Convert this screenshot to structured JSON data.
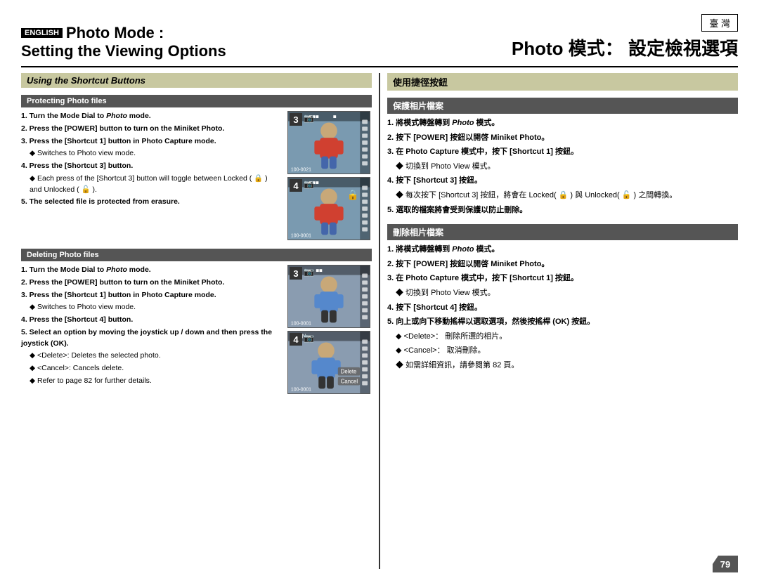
{
  "header": {
    "english_badge": "ENGLISH",
    "title_line1": "Photo Mode :",
    "title_line2": "Setting the Viewing Options",
    "taiwan_badge": "臺 灣",
    "chinese_title": "Photo 模式： 設定檢視選項"
  },
  "left": {
    "section_header": "Using the Shortcut Buttons",
    "protecting": {
      "subsection_header": "Protecting Photo files",
      "steps": [
        "1.  Turn the Mode Dial to Photo mode.",
        "2.  Press the [POWER] button to turn on the Miniket Photo.",
        "3.  Press the [Shortcut 1] button in Photo Capture mode.",
        "Switches to Photo view mode.",
        "4.  Press the [Shortcut 3] button.",
        "Each press of the [Shortcut 3] button will toggle between Locked ( 🔒 ) and Unlocked ( 🔓 ).",
        "5.  The selected file is protected from erasure."
      ]
    },
    "deleting": {
      "subsection_header": "Deleting Photo files",
      "steps": [
        "1.  Turn the Mode Dial to Photo mode.",
        "2.  Press the [POWER] button to turn on the Miniket Photo.",
        "3.  Press the [Shortcut 1] button in Photo Capture mode.",
        "Switches to Photo view mode.",
        "4.  Press the [Shortcut 4] button.",
        "5.  Select an option by moving the joystick up / down and then press the joystick (OK).",
        "<Delete>: Deletes the selected photo.",
        "<Cancel>: Cancels delete.",
        "Refer to page 82 for further details."
      ]
    }
  },
  "right": {
    "section_header": "使用捷徑按鈕",
    "protecting_header": "保護相片檔案",
    "protecting_steps": [
      "1.  將模式轉盤轉到 Photo 模式。",
      "2.  按下 [POWER] 按鈕以開啓 Miniket Photo。",
      "3.  在 Photo Capture 模式中，按下 [Shortcut 1] 按鈕。",
      "◆  切換到 Photo View 模式。",
      "4.  按下 [Shortcut 3] 按鈕。",
      "◆  每次按下 [Shortcut 3] 按鈕，將會在 Locked( 🔒 ) 與 Unlocked( 🔓 ) 之間轉換。",
      "5.  選取的檔案將會受到保護以防止刪除。"
    ],
    "deleting_header": "刪除相片檔案",
    "deleting_steps": [
      "1.  將模式轉盤轉到 Photo 模式。",
      "2.  按下 [POWER] 按鈕以開啓 Miniket Photo。",
      "3.  在 Photo Capture 模式中，按下 [Shortcut 1] 按鈕。",
      "◆  切換到 Photo View 模式。",
      "4.  按下 [Shortcut 4] 按鈕。",
      "5.  向上或向下移動搖桿以選取選項，然後按搖桿 (OK) 按鈕。",
      "◆  <Delete>：  刪除所選的相片。",
      "◆  <Cancel>：  取消刪除。",
      "◆  如需詳細資訊，請參閱第 82 頁。"
    ]
  },
  "page_number": "79",
  "camera_images": {
    "step3_counter": "100-0021",
    "step4_counter": "100-0001",
    "del_step3_counter": "100-0001",
    "del_step4_counter": "100-0001"
  }
}
